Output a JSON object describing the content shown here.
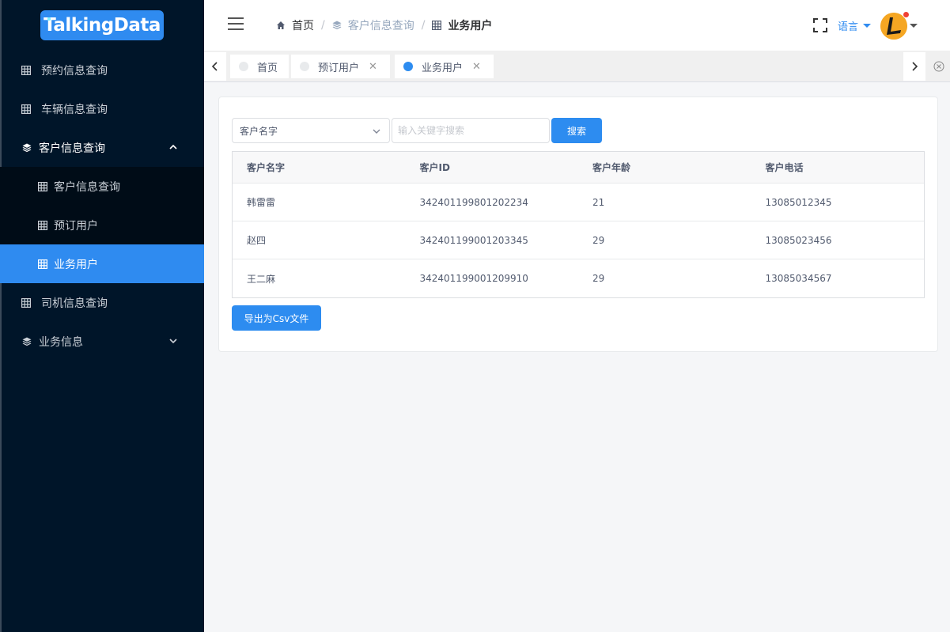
{
  "logo": {
    "text": "TalkingData"
  },
  "sidebar": {
    "items": [
      {
        "label": "预约信息查询",
        "icon": "grid-icon"
      },
      {
        "label": "车辆信息查询",
        "icon": "grid-icon"
      },
      {
        "label": "客户信息查询",
        "icon": "layers-icon",
        "expanded": true
      },
      {
        "label": "客户信息查询",
        "icon": "grid-icon"
      },
      {
        "label": "预订用户",
        "icon": "grid-icon"
      },
      {
        "label": "业务用户",
        "icon": "grid-icon",
        "active": true
      },
      {
        "label": "司机信息查询",
        "icon": "grid-icon"
      },
      {
        "label": "业务信息",
        "icon": "layers-icon",
        "expanded": false
      }
    ]
  },
  "header": {
    "breadcrumb": [
      "首页",
      "客户信息查询",
      "业务用户"
    ],
    "language": "语言"
  },
  "tabs": [
    {
      "label": "首页",
      "closable": false,
      "active": false
    },
    {
      "label": "预订用户",
      "closable": true,
      "active": false
    },
    {
      "label": "业务用户",
      "closable": true,
      "active": true
    }
  ],
  "search": {
    "field_selected": "客户名字",
    "placeholder": "输入关键字搜索",
    "button": "搜索"
  },
  "table": {
    "columns": [
      "客户名字",
      "客户ID",
      "客户年龄",
      "客户电话"
    ],
    "rows": [
      [
        "韩雷雷",
        "342401199801202234",
        "21",
        "13085012345"
      ],
      [
        "赵四",
        "342401199001203345",
        "29",
        "13085023456"
      ],
      [
        "王二麻",
        "342401199001209910",
        "29",
        "13085034567"
      ]
    ]
  },
  "export_button": "导出为Csv文件",
  "colors": {
    "sidebar_bg": "#001529",
    "accent": "#2f8bf0",
    "page_bg": "#f5f6f8"
  }
}
